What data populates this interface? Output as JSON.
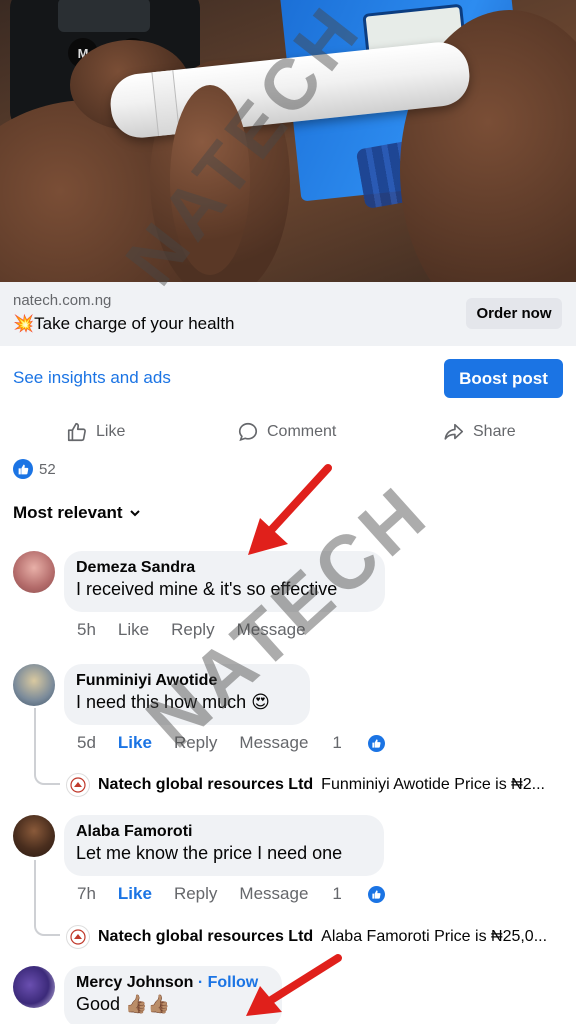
{
  "ad": {
    "domain": "natech.com.ng",
    "headline": "💥Take charge of your health",
    "cta_label": "Order now"
  },
  "post_actions": {
    "insights_link": "See insights and ads",
    "boost_label": "Boost post",
    "like_label": "Like",
    "comment_label": "Comment",
    "share_label": "Share"
  },
  "reactions": {
    "count": "52",
    "icon": "like-thumb-icon"
  },
  "sort": {
    "label": "Most relevant",
    "icon": "chevron-down-icon"
  },
  "comments": [
    {
      "name": "Demeza Sandra",
      "text": "I received mine & it's so effective",
      "time": "5h",
      "like": "Like",
      "reply": "Reply",
      "message": "Message"
    },
    {
      "name": "Funminiyi Awotide",
      "text": "I need this how much 😍",
      "time": "5d",
      "like": "Like",
      "reply": "Reply",
      "message": "Message",
      "likes": "1",
      "page_reply": {
        "name": "Natech global resources Ltd",
        "text": "Funminiyi Awotide Price is ₦2..."
      }
    },
    {
      "name": "Alaba Famoroti",
      "text": "Let me know the price I need one",
      "time": "7h",
      "like": "Like",
      "reply": "Reply",
      "message": "Message",
      "likes": "1",
      "page_reply": {
        "name": "Natech global resources Ltd",
        "text": "Alaba Famoroti Price is ₦25,0..."
      }
    },
    {
      "name": "Mercy Johnson",
      "follow": "· Follow",
      "text": "Good 👍🏽👍🏽"
    }
  ],
  "watermark": {
    "text": "NATECH"
  },
  "colors": {
    "accent": "#1b74e4",
    "bubble": "#f0f2f5",
    "arrow": "#e0201b",
    "muted": "#65676b"
  }
}
